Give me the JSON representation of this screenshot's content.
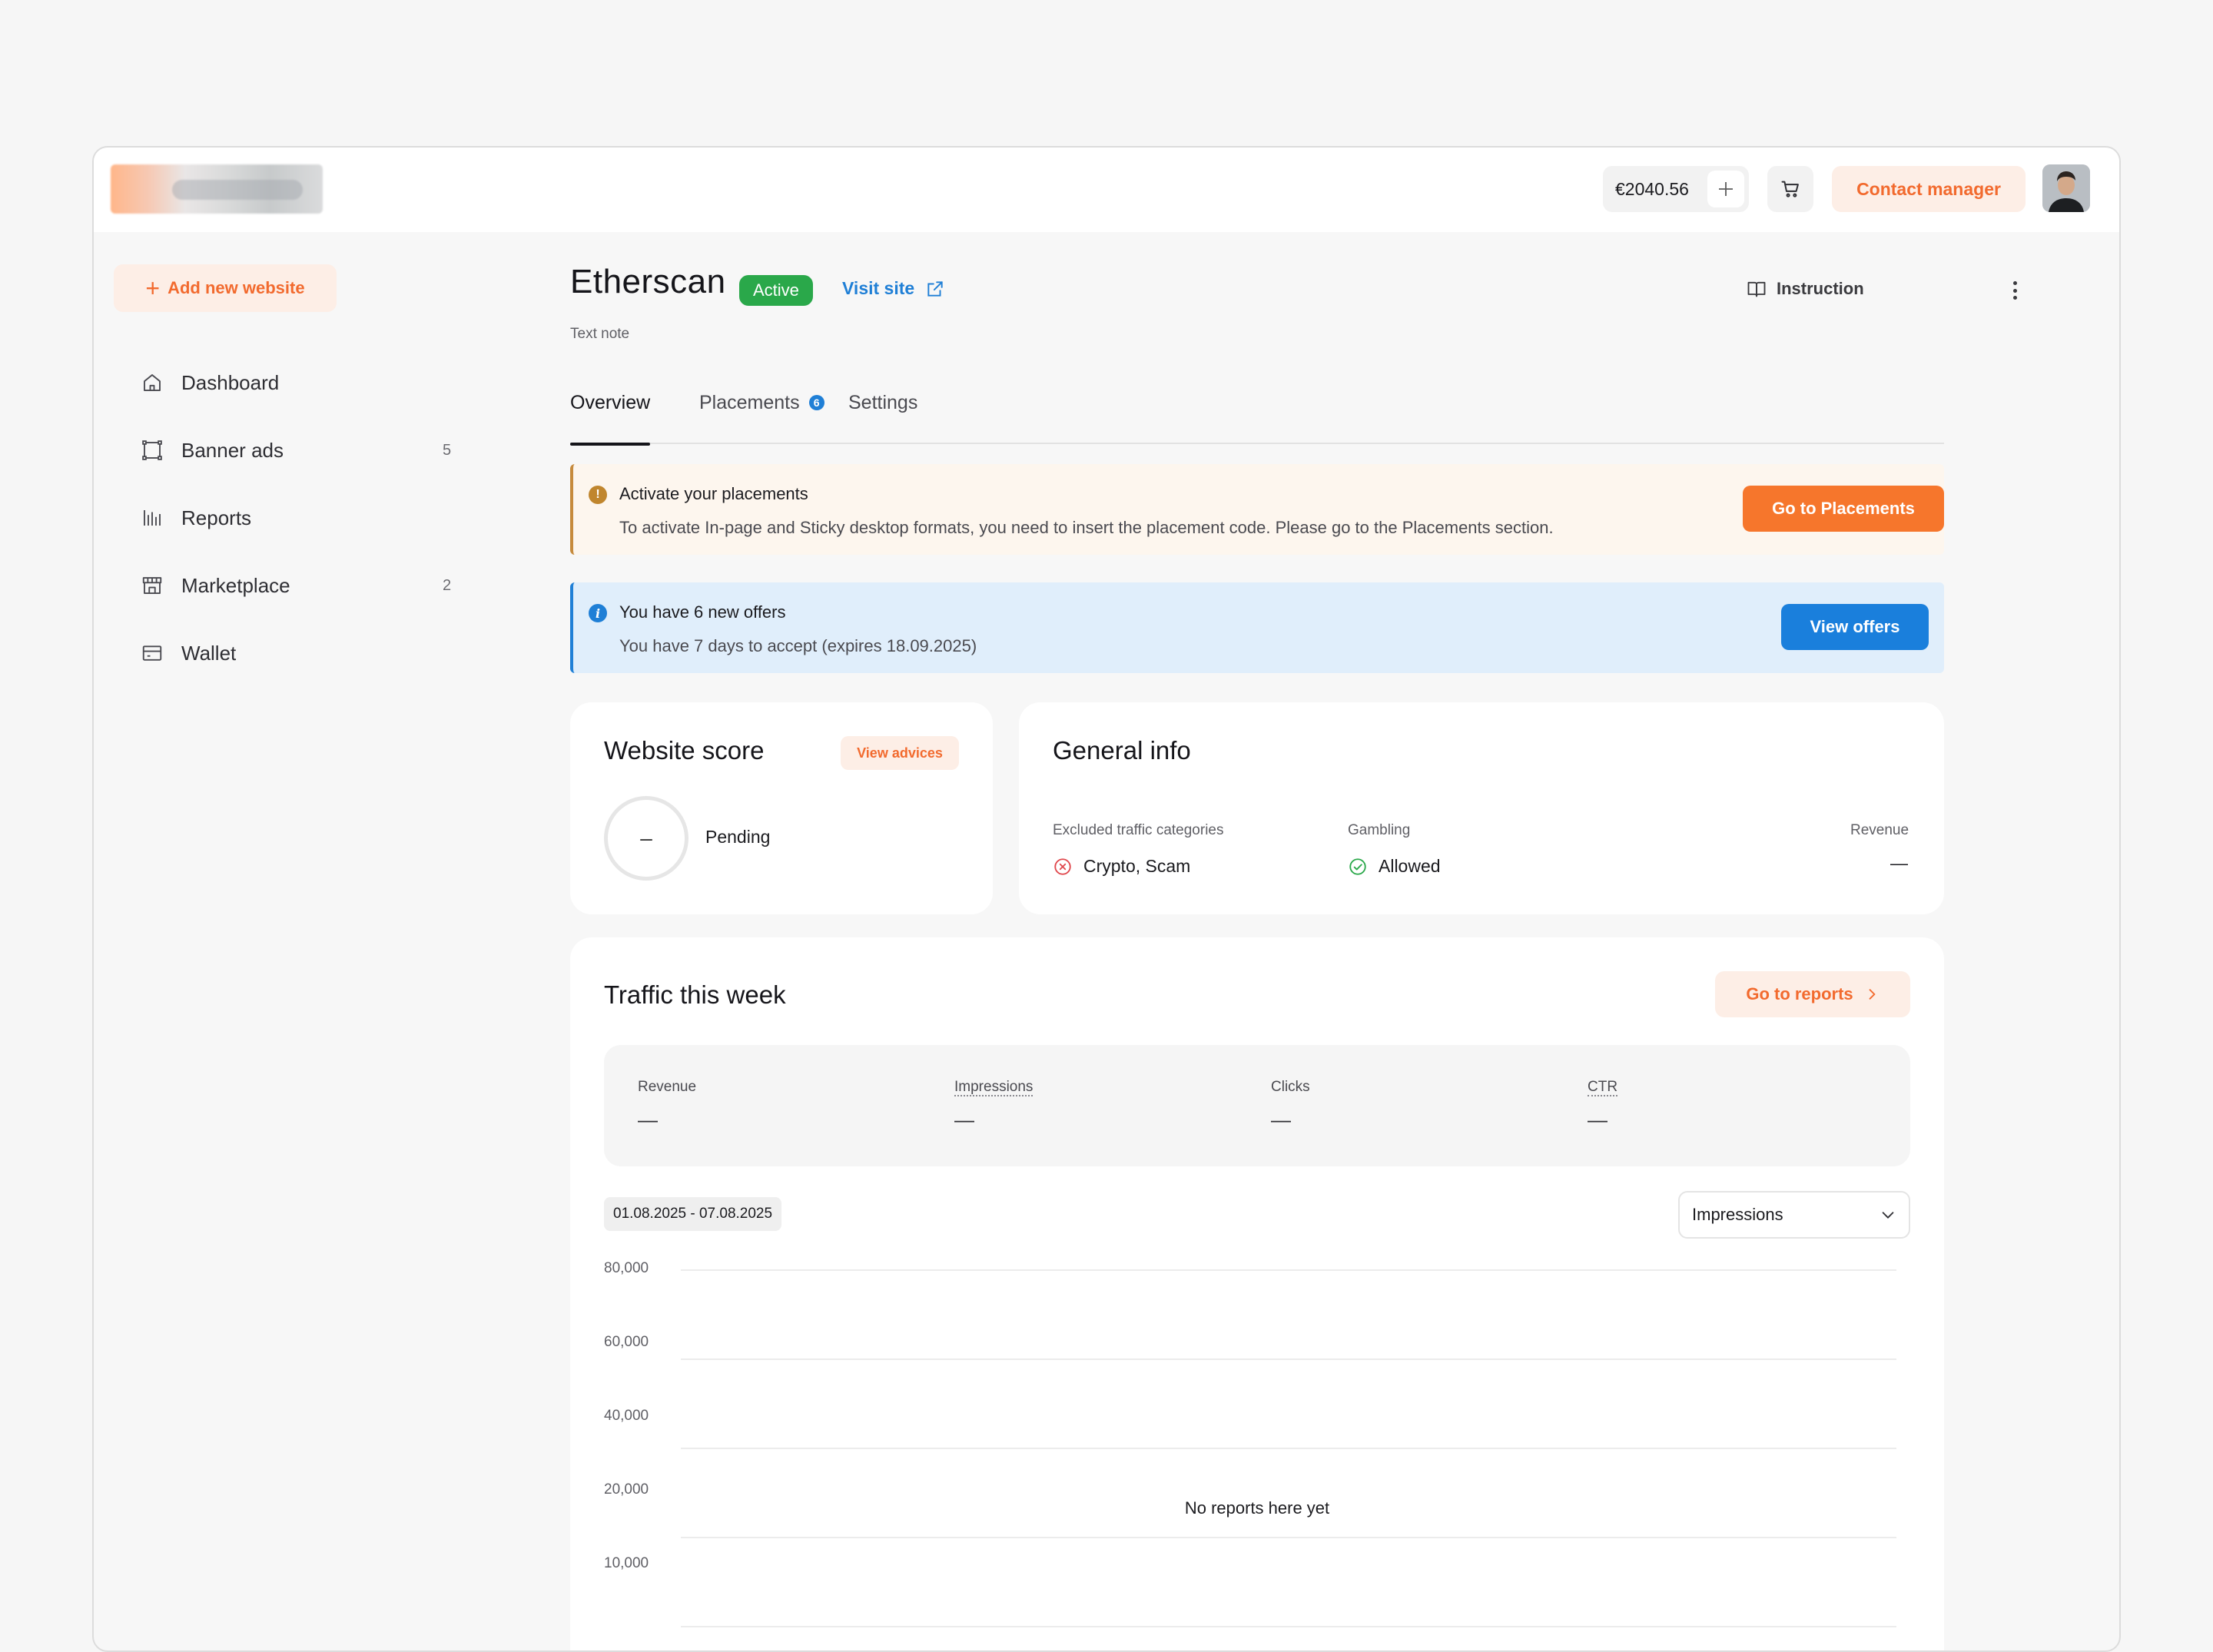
{
  "header": {
    "balance": "€2040.56",
    "contact_label": "Contact manager"
  },
  "sidebar": {
    "add_website_label": "Add new website",
    "items": [
      {
        "label": "Dashboard",
        "icon": "home-icon",
        "count": ""
      },
      {
        "label": "Banner ads",
        "icon": "banner-icon",
        "count": "5"
      },
      {
        "label": "Reports",
        "icon": "bar-chart-icon",
        "count": ""
      },
      {
        "label": "Marketplace",
        "icon": "store-icon",
        "count": "2"
      },
      {
        "label": "Wallet",
        "icon": "wallet-icon",
        "count": ""
      }
    ]
  },
  "page": {
    "title": "Etherscan",
    "status": "Active",
    "visit_site_label": "Visit site",
    "instruction_label": "Instruction",
    "note": "Text note"
  },
  "tabs": [
    {
      "label": "Overview",
      "active": true,
      "count": ""
    },
    {
      "label": "Placements",
      "active": false,
      "count": "6"
    },
    {
      "label": "Settings",
      "active": false,
      "count": ""
    }
  ],
  "alerts": {
    "warning": {
      "icon": "!",
      "title": "Activate your placements",
      "text": "To activate In-page and Sticky desktop formats, you need to insert the placement code. Please go to the Placements section.",
      "button": "Go to Placements"
    },
    "info": {
      "icon": "i",
      "title": "You have 6 new offers",
      "text": "You have 7 days to accept (expires 18.09.2025)",
      "button": "View offers"
    }
  },
  "score": {
    "title": "Website score",
    "advices_label": "View advices",
    "value": "–",
    "status": "Pending"
  },
  "general_info": {
    "title": "General info",
    "excluded_label": "Excluded traffic categories",
    "excluded_value": "Crypto, Scam",
    "gambling_label": "Gambling",
    "gambling_value": "Allowed",
    "revenue_label": "Revenue",
    "revenue_value": "—"
  },
  "traffic": {
    "title": "Traffic this week",
    "go_reports_label": "Go to reports",
    "metrics": [
      {
        "label": "Revenue",
        "value": "—"
      },
      {
        "label": "Impressions",
        "value": "—"
      },
      {
        "label": "Clicks",
        "value": "—"
      },
      {
        "label": "CTR",
        "value": "—"
      }
    ],
    "date_range": "01.08.2025 - 07.08.2025",
    "metric_select": "Impressions",
    "empty_message": "No reports here yet"
  },
  "chart_data": {
    "type": "line",
    "y_ticks": [
      "80,000",
      "60,000",
      "40,000",
      "20,000",
      "10,000"
    ],
    "series": [],
    "grid": true
  },
  "colors": {
    "accent_orange": "#f26a2e",
    "accent_blue": "#1f7fd6",
    "success_green": "#2aa84a",
    "danger_red": "#e0474c"
  }
}
